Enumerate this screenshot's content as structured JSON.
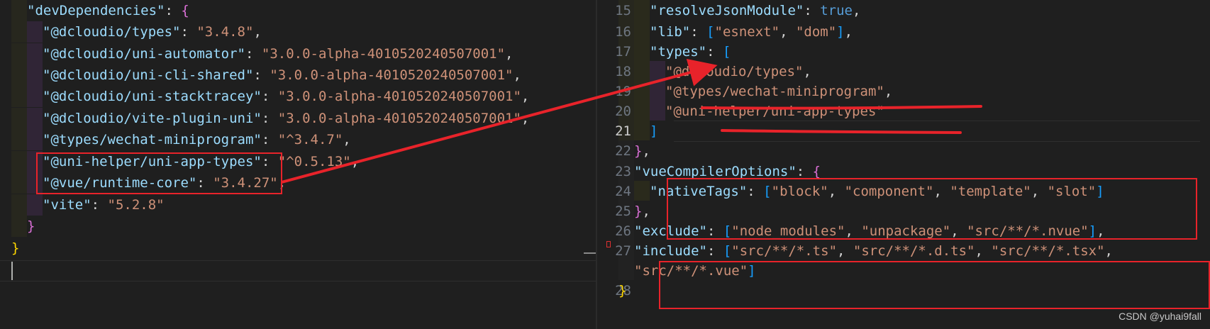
{
  "left": {
    "lines": [
      {
        "kind": "obj-open",
        "key": "devDependencies"
      },
      {
        "kind": "kv",
        "key": "@dcloudio/types",
        "value": "3.4.8"
      },
      {
        "kind": "kv",
        "key": "@dcloudio/uni-automator",
        "value": "3.0.0-alpha-4010520240507001"
      },
      {
        "kind": "kv",
        "key": "@dcloudio/uni-cli-shared",
        "value": "3.0.0-alpha-4010520240507001"
      },
      {
        "kind": "kv",
        "key": "@dcloudio/uni-stacktracey",
        "value": "3.0.0-alpha-4010520240507001"
      },
      {
        "kind": "kv",
        "key": "@dcloudio/vite-plugin-uni",
        "value": "3.0.0-alpha-4010520240507001"
      },
      {
        "kind": "kv",
        "key": "@types/wechat-miniprogram",
        "value": "^3.4.7"
      },
      {
        "kind": "kv",
        "key": "@uni-helper/uni-app-types",
        "value": "^0.5.13"
      },
      {
        "kind": "kv",
        "key": "@vue/runtime-core",
        "value": "3.4.27"
      },
      {
        "kind": "kv-last",
        "key": "vite",
        "value": "5.2.8"
      },
      {
        "kind": "close",
        "text": "}"
      },
      {
        "kind": "close-root",
        "text": "}"
      }
    ]
  },
  "right": {
    "lines": [
      {
        "num": "15",
        "kind": "kv-bool",
        "key": "resolveJsonModule",
        "value": "true"
      },
      {
        "num": "16",
        "kind": "kv-arr",
        "key": "lib",
        "items": [
          "esnext",
          "dom"
        ]
      },
      {
        "num": "17",
        "kind": "arr-open",
        "key": "types"
      },
      {
        "num": "18",
        "kind": "item",
        "value": "@dcloudio/types"
      },
      {
        "num": "19",
        "kind": "item",
        "value": "@types/wechat-miniprogram"
      },
      {
        "num": "20",
        "kind": "item-last",
        "value": "@uni-helper/uni-app-types"
      },
      {
        "num": "21",
        "kind": "arr-close",
        "text": "]"
      },
      {
        "num": "22",
        "kind": "obj-close",
        "text": "},"
      },
      {
        "num": "23",
        "kind": "obj-open",
        "key": "vueCompilerOptions"
      },
      {
        "num": "24",
        "kind": "kv-arr-last",
        "key": "nativeTags",
        "items": [
          "block",
          "component",
          "template",
          "slot"
        ]
      },
      {
        "num": "25",
        "kind": "obj-close",
        "text": "},"
      },
      {
        "num": "26",
        "kind": "kv-arr",
        "key": "exclude",
        "items": [
          "node_modules",
          "unpackage",
          "src/**/*.nvue"
        ]
      },
      {
        "num": "27",
        "kind": "kv-arr-wrap",
        "key": "include",
        "items": [
          "src/**/*.ts",
          "src/**/*.d.ts",
          "src/**/*.tsx"
        ],
        "wrap_items": [
          "src/**/*.vue"
        ]
      },
      {
        "num": "28",
        "kind": "root-close",
        "text": "}"
      }
    ],
    "active_line": "21"
  },
  "watermark": "CSDN @yuhai9fall",
  "colors": {
    "background": "#1f1f1f",
    "key": "#9cdcfe",
    "string": "#ce9178",
    "keyword": "#569cd6",
    "annotation": "#e8232a",
    "bracket_gold": "#ffd700",
    "bracket_pink": "#da70d6",
    "bracket_blue": "#179fff"
  }
}
